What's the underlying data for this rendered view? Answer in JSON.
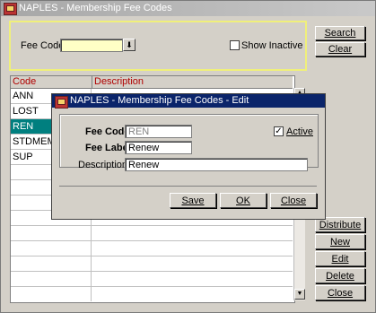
{
  "window": {
    "title": "NAPLES - Membership Fee Codes"
  },
  "search": {
    "fee_code_label": "Fee Code",
    "fee_code_value": "",
    "show_inactive_label": "Show Inactive",
    "show_inactive_checked": false,
    "dropdown_glyph": "⬇"
  },
  "buttons": {
    "search": "Search",
    "clear": "Clear",
    "distribute": "Distribute",
    "new": "New",
    "edit": "Edit",
    "delete": "Delete",
    "close": "Close"
  },
  "grid": {
    "columns": [
      "Code",
      "Description"
    ],
    "rows": [
      {
        "code": "ANN",
        "description": ""
      },
      {
        "code": "LOST",
        "description": ""
      },
      {
        "code": "REN",
        "description": ""
      },
      {
        "code": "STDMEM",
        "description": ""
      },
      {
        "code": "SUP",
        "description": ""
      }
    ],
    "selected_code": "REN"
  },
  "dialog": {
    "title": "NAPLES - Membership Fee Codes - Edit",
    "fee_code_label": "Fee Code",
    "fee_code_value": "REN",
    "fee_label_label": "Fee Label",
    "fee_label_value": "Renew",
    "description_label": "Description",
    "description_value": "Renew",
    "active_label": "Active",
    "active_checked": true,
    "save": "Save",
    "ok": "OK",
    "close": "Close"
  },
  "colors": {
    "selection": "#007f7f",
    "dialog_title_bar": "#0a246a",
    "search_panel_border": "#f0f07a",
    "mandatory_field": "#ffffc6",
    "column_header_text": "#b00000"
  },
  "icons": {
    "app_icon": "opera-app-icon",
    "dropdown": "down-arrow-icon",
    "scroll_up": "scroll-up-icon",
    "scroll_down": "scroll-down-icon"
  }
}
